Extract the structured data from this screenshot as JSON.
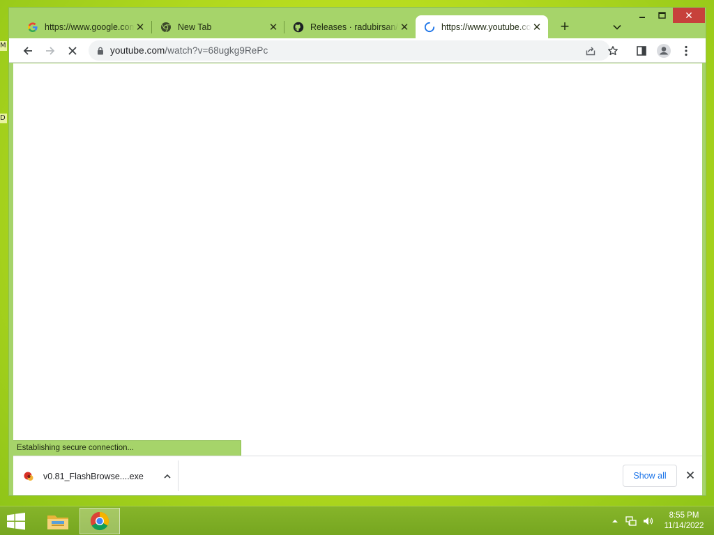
{
  "browser": {
    "tabs": [
      {
        "title": "https://www.google.com",
        "favicon": "google-icon",
        "active": false
      },
      {
        "title": "New Tab",
        "favicon": "chrome-icon",
        "active": false
      },
      {
        "title": "Releases · radubirsan/FlashBrowser",
        "favicon": "github-icon",
        "active": false
      },
      {
        "title": "https://www.youtube.com",
        "favicon": "loading-spinner-icon",
        "active": true
      }
    ],
    "new_tab_label": "+",
    "address": {
      "host": "youtube.com",
      "path": "/watch?v=68ugkg9RePc"
    },
    "status_text": "Establishing secure connection..."
  },
  "downloads": {
    "item_name": "v0.81_FlashBrowse....exe",
    "show_all_label": "Show all"
  },
  "taskbar": {
    "time": "8:55 PM",
    "date": "11/14/2022"
  },
  "desktop": {
    "edge_labels": [
      "M",
      "D"
    ]
  },
  "colors": {
    "frame": "#a6d46a",
    "close_button": "#c7413b",
    "link": "#1a73e8",
    "desktop": "#b9dd1f"
  }
}
